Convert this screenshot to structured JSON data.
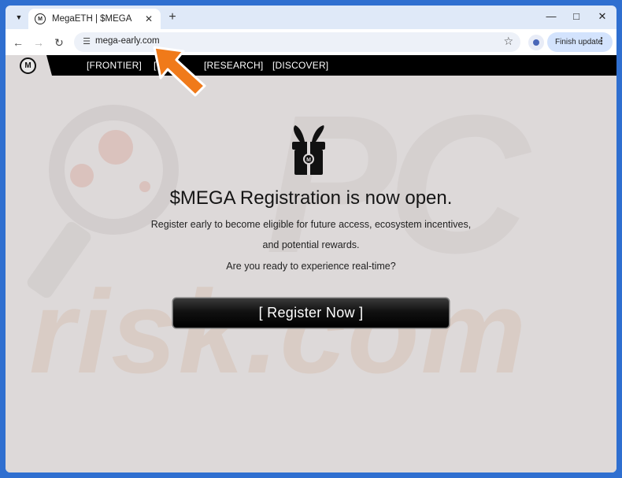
{
  "browser": {
    "tab_title": "MegaETH | $MEGA",
    "favicon_letter": "M",
    "url": "mega-early.com",
    "update_label": "Finish update"
  },
  "site": {
    "logo_letter": "M",
    "nav_items": [
      "[FRONTIER]",
      "[",
      "[RESEARCH]",
      "[DISCOVER]"
    ],
    "headline": "$MEGA Registration is now open.",
    "paragraph_line1": "Register early to become eligible for future access, ecosystem incentives,",
    "paragraph_line2": "and potential rewards.",
    "question": "Are you ready to experience real-time?",
    "register_label": "[ Register Now ]"
  },
  "watermark": {
    "pc": "PC",
    "risk": "risk.com"
  },
  "colors": {
    "accent_arrow": "#f07a1a",
    "page_bg": "#ddd9d9",
    "navbar": "#000000"
  }
}
